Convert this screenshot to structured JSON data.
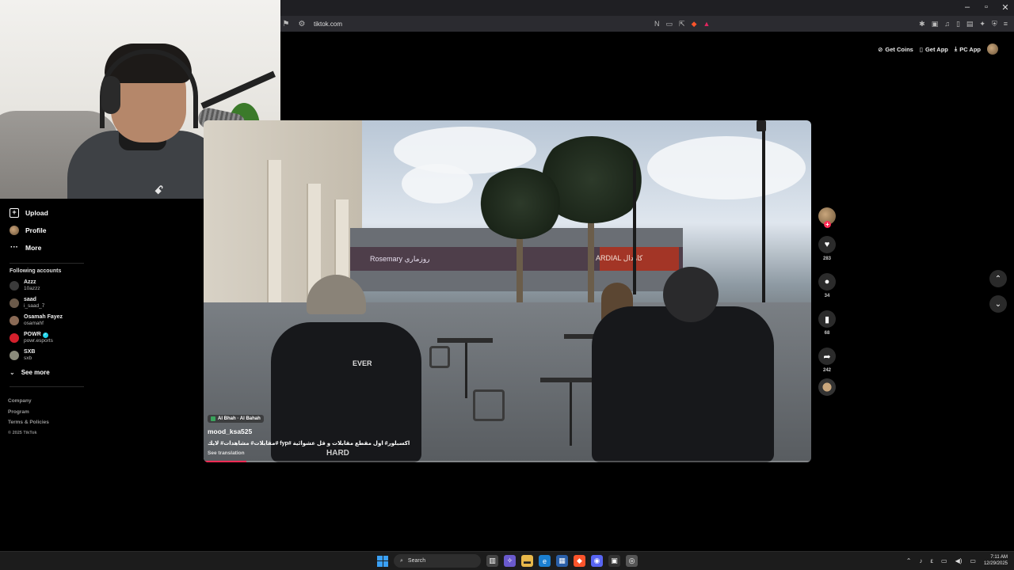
{
  "browser": {
    "url": "tiktok.com",
    "window_controls": [
      "–",
      "▫",
      "✕"
    ]
  },
  "tiktok_header": {
    "get_coins": "Get Coins",
    "get_app": "Get App",
    "pc_app": "PC App"
  },
  "webcam": {
    "visible_text": "ꗃ"
  },
  "sidebar": {
    "nav": [
      {
        "label": "Upload",
        "icon": "upload-icon"
      },
      {
        "label": "Profile",
        "icon": "avatar"
      },
      {
        "label": "More",
        "icon": "more-icon"
      }
    ],
    "following_title": "Following accounts",
    "accounts": [
      {
        "name": "Azzz",
        "id": "10azzz",
        "color": "#3a3a3a",
        "verified": false
      },
      {
        "name": "saad",
        "id": "i_saad_7",
        "color": "#6b5a4a",
        "verified": false
      },
      {
        "name": "Osamah Fayez",
        "id": "osamahf",
        "color": "#8a6a55",
        "verified": false
      },
      {
        "name": "POWR",
        "id": "powr.esports",
        "color": "#d4202c",
        "verified": true
      },
      {
        "name": "SXB",
        "id": "sxb",
        "color": "#8a8a7a",
        "verified": false
      }
    ],
    "see_more": "See more",
    "footer": {
      "company": "Company",
      "program": "Program",
      "terms": "Terms & Policies",
      "copyright": "© 2025 TikTok"
    }
  },
  "video": {
    "location": "Al Bhah · Al Bahah",
    "author": "mood_ksa525",
    "description": "مقابلات# مشاهدات# لايك# fyp# اكسبلور# اول مقطع مقابلات و قل عشوائية",
    "see_translation": "See translation",
    "progress": 0.07,
    "scene_sign_1": "Rosemary روزماري",
    "scene_sign_2": "ARDIAL كاردال",
    "scene_shirt": "EVER",
    "scene_shirt_2": "HARD"
  },
  "actions": {
    "likes": "283",
    "comments": "34",
    "saves": "68",
    "shares": "242"
  },
  "taskbar": {
    "search_placeholder": "Search",
    "time": "7:11 AM",
    "date": "12/29/2025",
    "lang": "ε"
  },
  "colors": {
    "accent": "#fe2c55",
    "verified": "#20d5ec"
  }
}
